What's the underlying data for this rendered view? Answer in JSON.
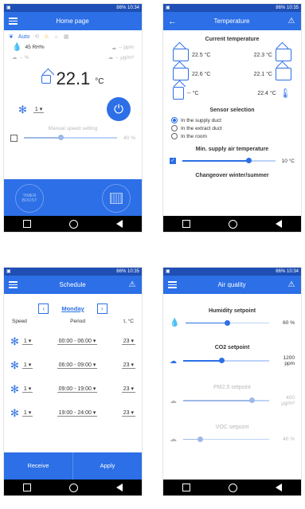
{
  "screens": {
    "home": {
      "time": "10:34",
      "battery": "86%",
      "title": "Home page",
      "mode": "Auto",
      "humidity": "45 RH%",
      "co2": "-- ppm",
      "voc": "-- %",
      "pm25": "-- μg/m³",
      "temperature": "22.1",
      "temp_unit": "°C",
      "speed_value": "1",
      "manual_speed_label": "Manual speed setting",
      "manual_speed_value": "40 %",
      "manual_speed_fraction": 0.4,
      "timer_label": "TIMER BOOST",
      "colors": {
        "accent": "#2c6fe6",
        "statusbar": "#1f4fb4"
      }
    },
    "temperature": {
      "time": "10:35",
      "battery": "86%",
      "title": "Temperature",
      "current_title": "Current temperature",
      "readings": [
        {
          "value": "22.5 °C",
          "side": "left"
        },
        {
          "value": "22.3 °C",
          "side": "right"
        },
        {
          "value": "22.6 °C",
          "side": "left"
        },
        {
          "value": "22.1 °C",
          "side": "right"
        },
        {
          "value": "-- °C",
          "side": "left"
        },
        {
          "value": "22.4 °C",
          "side": "right"
        }
      ],
      "sensor_title": "Sensor selection",
      "sensor_options": [
        "In the supply duct",
        "In the extract duct",
        "In the room"
      ],
      "sensor_selected": 0,
      "min_supply_title": "Min. supply air temperature",
      "min_supply_value": "10 °C",
      "min_supply_fraction": 0.72,
      "changeover_title": "Changeover winter/summer"
    },
    "schedule": {
      "time": "10:35",
      "battery": "86%",
      "title": "Schedule",
      "day": "Monday",
      "headers": [
        "Speed",
        "Period",
        "t, °C"
      ],
      "rows": [
        {
          "speed": "1",
          "period": "00:00 - 06:00",
          "temp": "23"
        },
        {
          "speed": "1",
          "period": "06:00 - 09:00",
          "temp": "23"
        },
        {
          "speed": "1",
          "period": "09:00 - 19:00",
          "temp": "23"
        },
        {
          "speed": "1",
          "period": "19:00 - 24:00",
          "temp": "23"
        }
      ],
      "receive_label": "Receive",
      "apply_label": "Apply"
    },
    "air_quality": {
      "time": "10:34",
      "battery": "86%",
      "title": "Air quality",
      "items": [
        {
          "title": "Humidity setpoint",
          "value": "60 %",
          "fraction": 0.5,
          "enabled": true,
          "icon": "droplet-icon"
        },
        {
          "title": "CO2 setpoint",
          "value": "1200 ppm",
          "fraction": 0.45,
          "enabled": true,
          "icon": "co2-icon"
        },
        {
          "title": "PM2.5 setpoint",
          "value": "400 μg/m³",
          "fraction": 0.8,
          "enabled": false,
          "icon": "pm25-icon"
        },
        {
          "title": "VOC setpoint",
          "value": "40 %",
          "fraction": 0.2,
          "enabled": false,
          "icon": "voc-icon"
        }
      ]
    }
  }
}
